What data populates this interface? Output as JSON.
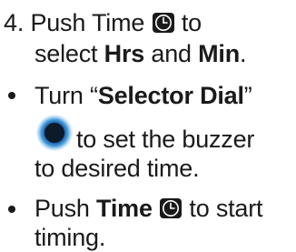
{
  "step4": {
    "number": "4.",
    "line1_a": "Push Time",
    "line1_b": "to",
    "line2_a": "select ",
    "line2_b": "Hrs",
    "line2_c": " and ",
    "line2_d": "Min",
    "line2_e": "."
  },
  "bullet1": {
    "line1_a": "Turn “",
    "line1_b": "Selector Dial",
    "line1_c": "”",
    "line2": "to set the buzzer",
    "line3_a": "to desired time",
    "line3_b": "."
  },
  "bullet2": {
    "line1_a": "Push ",
    "line1_b": "Time",
    "line1_c": "to start",
    "line2_a": "timing",
    "line2_b": "."
  },
  "icons": {
    "clock": "clock-icon",
    "dial": "selector-dial-icon",
    "dial_color": "#3a86c8"
  }
}
